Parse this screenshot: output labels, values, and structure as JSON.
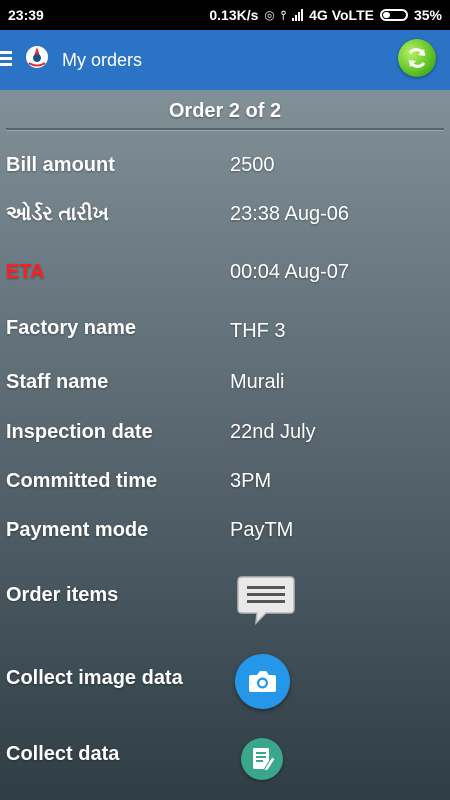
{
  "status_bar": {
    "time": "23:39",
    "network_speed": "0.13K/s",
    "network_type": "4G VoLTE",
    "battery": "35%"
  },
  "app_bar": {
    "title": "My orders",
    "menu_icon": "menu-icon",
    "logo_icon": "app-logo-icon",
    "refresh_icon": "refresh-icon"
  },
  "order": {
    "header": "Order 2 of 2",
    "fields": [
      {
        "label": "Bill amount",
        "value": "2500"
      },
      {
        "label": "ઓર્ડર તારીખ",
        "value": "23:38 Aug-06"
      },
      {
        "label": "ETA",
        "value": "00:04 Aug-07"
      },
      {
        "label": "Factory name",
        "value": "THF 3"
      },
      {
        "label": "Staff name",
        "value": "Murali"
      },
      {
        "label": "Inspection date",
        "value": "22nd July"
      },
      {
        "label": "Committed time",
        "value": "3PM"
      },
      {
        "label": "Payment mode",
        "value": "PayTM"
      }
    ],
    "actions": [
      {
        "label": "Order items",
        "icon": "chat-bubble-icon"
      },
      {
        "label": "Collect image data",
        "icon": "camera-icon"
      },
      {
        "label": "Collect data",
        "icon": "form-edit-icon"
      }
    ]
  },
  "colors": {
    "app_bar": "#2a73c5",
    "eta_label": "#ff1e1e",
    "camera_button": "#2597e8",
    "data_button": "#3aa68c"
  }
}
